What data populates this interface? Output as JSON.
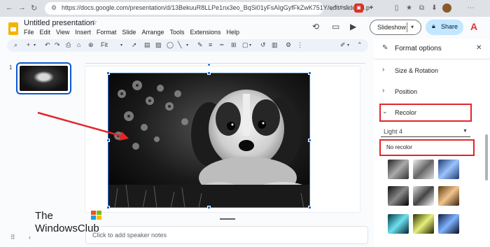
{
  "browser": {
    "url": "https://docs.google.com/presentation/d/13BekuuR8LLPe1nx3eo_BqSi01yFsAIgGyfFkZwK751Y/edit#slide=id.p",
    "back_icon": "back-arrow-icon",
    "forward_icon": "forward-arrow-icon",
    "refresh_icon": "refresh-icon"
  },
  "header": {
    "title": "Untitled presentation",
    "menu": [
      "File",
      "Edit",
      "View",
      "Insert",
      "Format",
      "Slide",
      "Arrange",
      "Tools",
      "Extensions",
      "Help"
    ],
    "slideshow_label": "Slideshow",
    "share_label": "Share"
  },
  "toolbar": {
    "zoom_label": "Fit"
  },
  "filmstrip": {
    "slide_number": "1"
  },
  "notes": {
    "placeholder": "Click to add speaker notes"
  },
  "watermark": {
    "line1": "The",
    "line2": "WindowsClub"
  },
  "format_panel": {
    "title": "Format options",
    "sections": [
      {
        "label": "Size & Rotation",
        "expanded": false
      },
      {
        "label": "Position",
        "expanded": false
      },
      {
        "label": "Recolor",
        "expanded": true
      }
    ],
    "recolor_selected": "Light 4",
    "recolor_options": [
      "No recolor"
    ]
  },
  "colors": {
    "accent": "#0b57d0",
    "share_bg": "#c2e7ff",
    "annotation_red": "#e3262b"
  }
}
